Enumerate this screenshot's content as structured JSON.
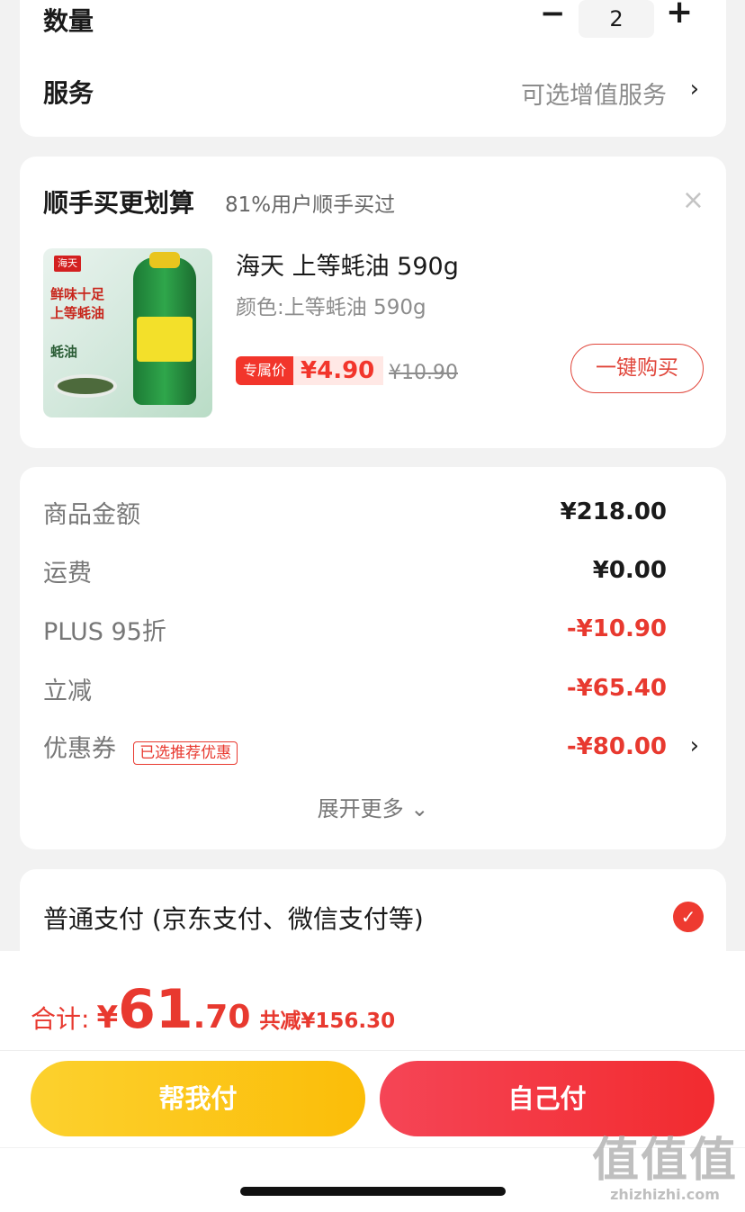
{
  "quantity": {
    "label": "数量",
    "minus": "−",
    "value": "2",
    "plus": "+"
  },
  "service": {
    "label": "服务",
    "value": "可选增值服务",
    "chevron": "›"
  },
  "recommend": {
    "title": "顺手买更划算",
    "subtitle": "81%用户顺手买过",
    "close": "×",
    "product": {
      "name": "海天 上等蚝油 590g",
      "color": "颜色:上等蚝油 590g",
      "badge": "专属价",
      "price": "¥4.90",
      "original_price": "¥10.90",
      "buy_label": "一键购买",
      "image_logo": "海天",
      "image_text1": "鲜味十足\n上等蚝油",
      "image_text2": "蚝油"
    }
  },
  "summary": {
    "rows": [
      {
        "label": "商品金额",
        "value": "¥218.00"
      },
      {
        "label": "运费",
        "value": "¥0.00"
      },
      {
        "label": "PLUS 95折",
        "value": "-¥10.90"
      },
      {
        "label": "立减",
        "value": "-¥65.40"
      },
      {
        "label": "优惠券",
        "value": "-¥80.00",
        "badge": "已选推荐优惠"
      }
    ],
    "expand": "展开更多 ⌄"
  },
  "payment": {
    "label": "普通支付 (京东支付、微信支付等)",
    "check": "✓"
  },
  "total": {
    "prefix": "合计:",
    "yen": "¥",
    "int": "61",
    "dec": ".70",
    "saved": "共减¥156.30"
  },
  "buttons": {
    "help_pay": "帮我付",
    "self_pay": "自己付"
  },
  "watermark": {
    "big": "值值值",
    "small": "zhizhizhi.com"
  },
  "colors": {
    "accent_red": "#e8392f",
    "yellow": "#fbbd08",
    "background": "#f2f2f2"
  }
}
